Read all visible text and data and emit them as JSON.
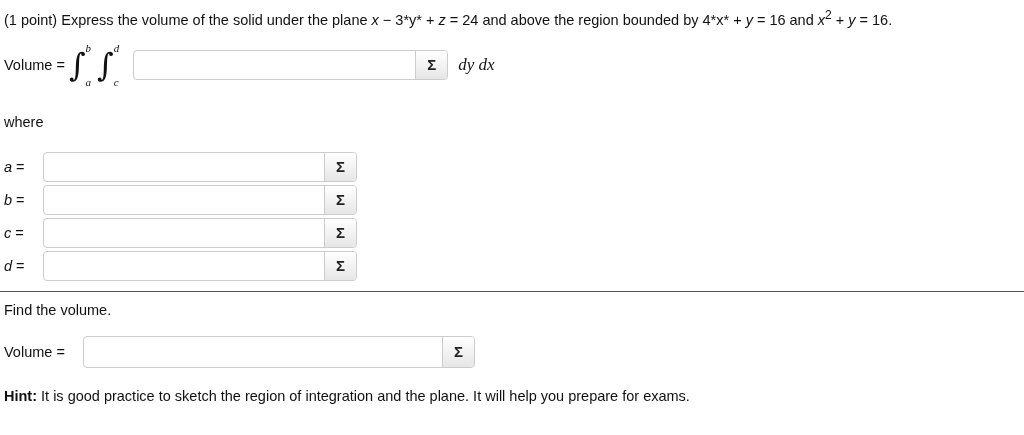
{
  "problem": "(1 point) Express the volume of the solid under the plane *x* − 3*y* + *z* = 24 and above the region bounded by 4*x* + *y* = 16 and *x*$^{2}$ + *y* = 16.",
  "integral": {
    "label": "Volume =",
    "signs": [
      {
        "sign": "∫",
        "upper": "b",
        "lower": "a"
      },
      {
        "sign": "∫",
        "upper": "d",
        "lower": "c"
      }
    ],
    "button": "Σ",
    "differential": "dy dx"
  },
  "where": "where",
  "bounds": [
    {
      "label": "*a* =",
      "button": "Σ"
    },
    {
      "label": "*b* =",
      "button": "Σ"
    },
    {
      "label": "*c* =",
      "button": "Σ"
    },
    {
      "label": "*d* =",
      "button": "Σ"
    }
  ],
  "find": "Find the volume.",
  "volume": {
    "label": "Volume =",
    "button": "Σ"
  },
  "hint": "**Hint:** It is good practice to sketch the region of integration and the plane. It will help you prepare for exams."
}
